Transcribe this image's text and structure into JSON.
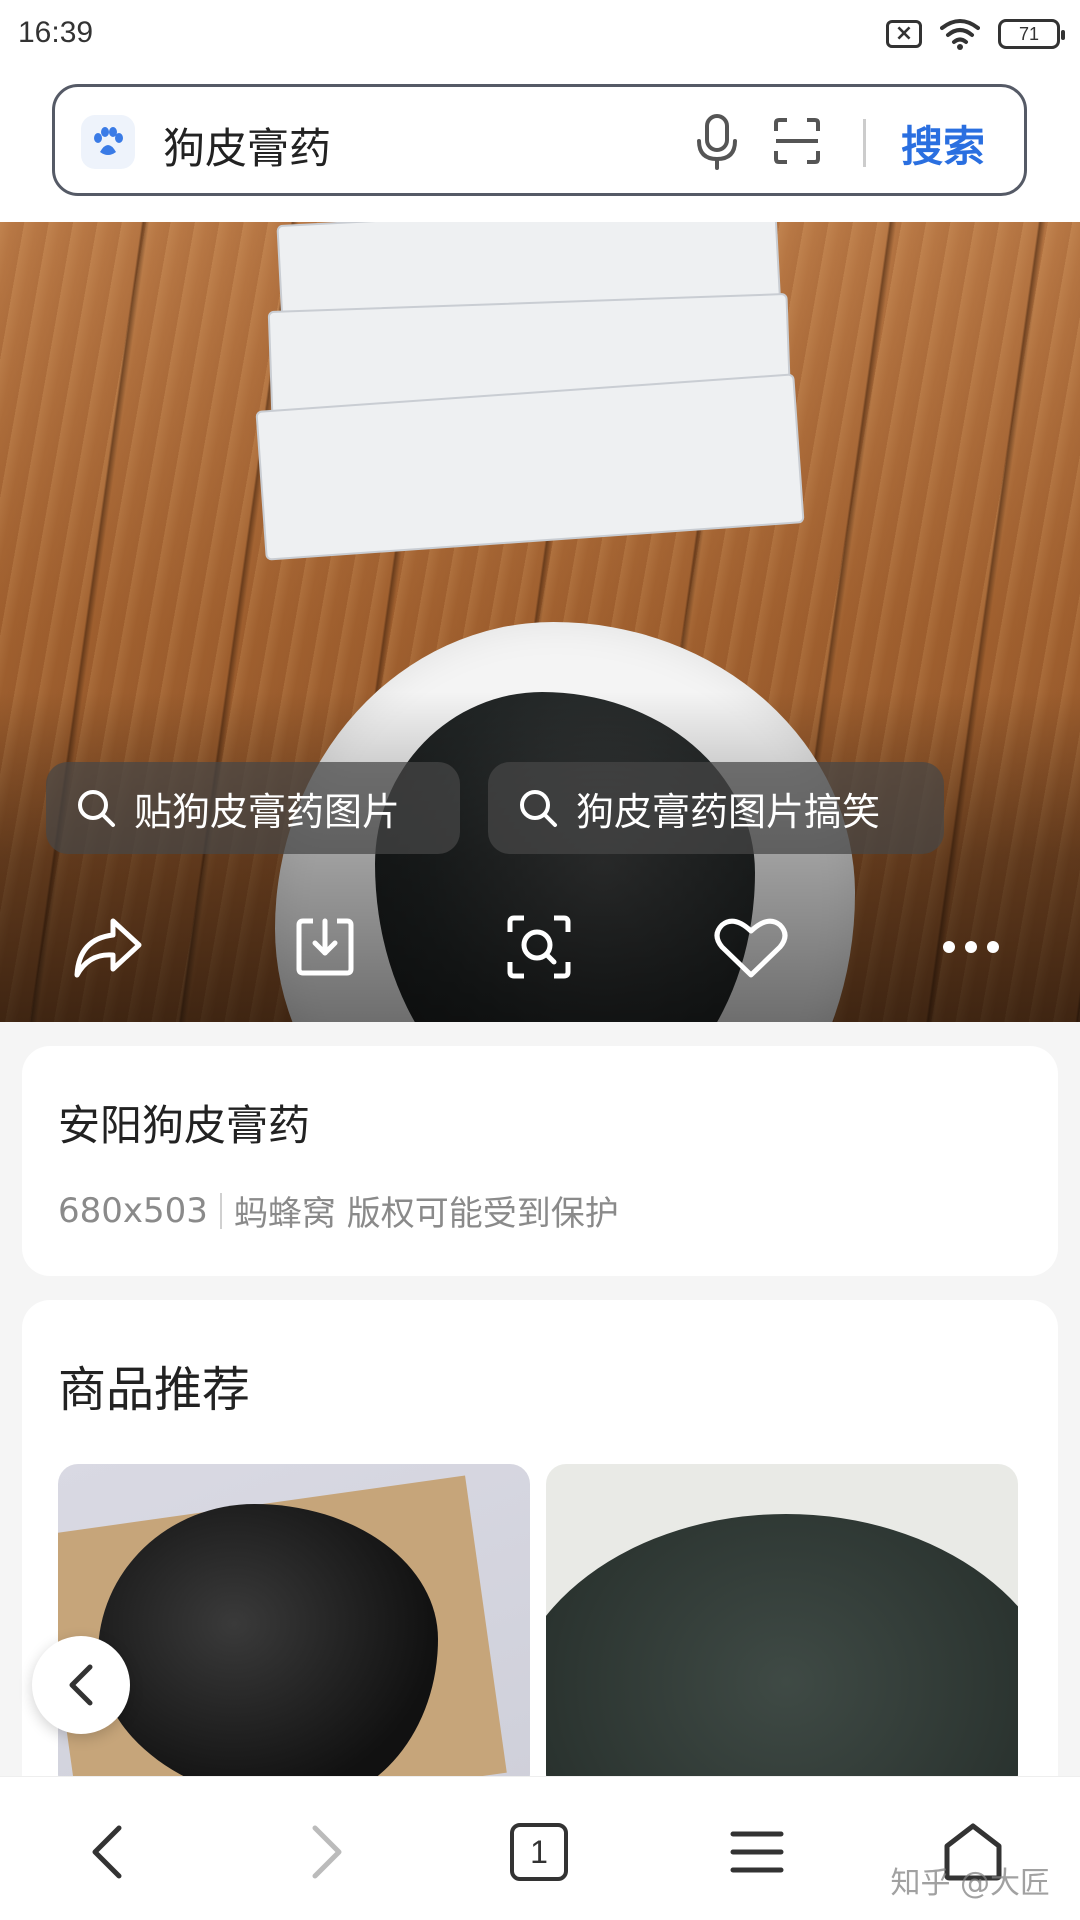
{
  "status_bar": {
    "time": "16:39",
    "battery": "71",
    "sim_icon": "sim-off-icon",
    "wifi_icon": "wifi-icon"
  },
  "search": {
    "query": "狗皮膏药",
    "submit_label": "搜索",
    "accent_color": "#2a6fe0"
  },
  "hero": {
    "related_searches": [
      {
        "label": "贴狗皮膏药图片"
      },
      {
        "label": "狗皮膏药图片搞笑"
      }
    ],
    "actions": [
      "share-icon",
      "download-icon",
      "image-search-icon",
      "favorite-icon",
      "more-icon"
    ]
  },
  "info": {
    "title": "安阳狗皮膏药",
    "dimensions": "680x503",
    "source": "蚂蜂窝 版权可能受到保护"
  },
  "recommend": {
    "title": "商品推荐"
  },
  "bottom_nav": {
    "tab_count": "1",
    "items": [
      "back-icon",
      "forward-icon",
      "tabs-icon",
      "menu-icon",
      "home-icon"
    ]
  },
  "watermark": "知乎 @大匠"
}
